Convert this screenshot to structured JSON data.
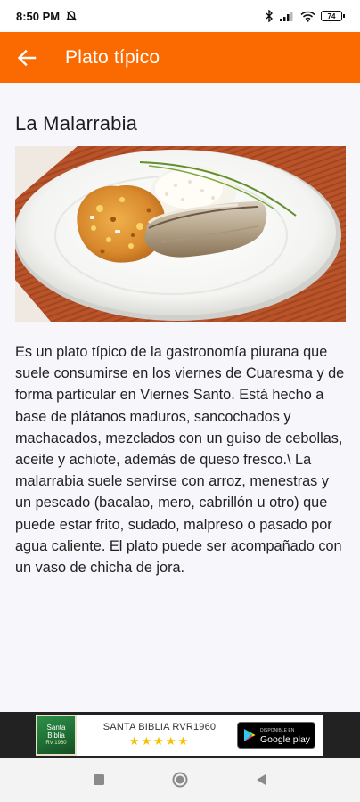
{
  "status_bar": {
    "time": "8:50 PM",
    "battery": "74"
  },
  "app_bar": {
    "title": "Plato típico",
    "color": "#fb6a00"
  },
  "dish": {
    "title": "La Malarrabia",
    "description": "Es un plato típico de la gastronomía piurana que suele consumirse en los viernes de Cuaresma y de forma particular en Viernes Santo. Está hecho a base de plátanos maduros, sancochados y machacados, mezclados con un guiso de cebollas, aceite y achiote, además de queso fresco.\\ La malarrabia suele servirse con arroz, menestras y un pescado (bacalao, mero, cabrillón u otro) que puede estar frito, sudado, malpreso o pasado por agua caliente. El plato puede ser acompañado con un vaso de chicha de jora."
  },
  "ad": {
    "icon_text_top": "Santa",
    "icon_text_mid": "Biblia",
    "icon_text_small": "RV 1960",
    "app_name": "SANTA BIBLIA RVR1960",
    "stars": "★★★★★",
    "store_small": "DISPONIBLE EN",
    "store_label": "Google play"
  }
}
